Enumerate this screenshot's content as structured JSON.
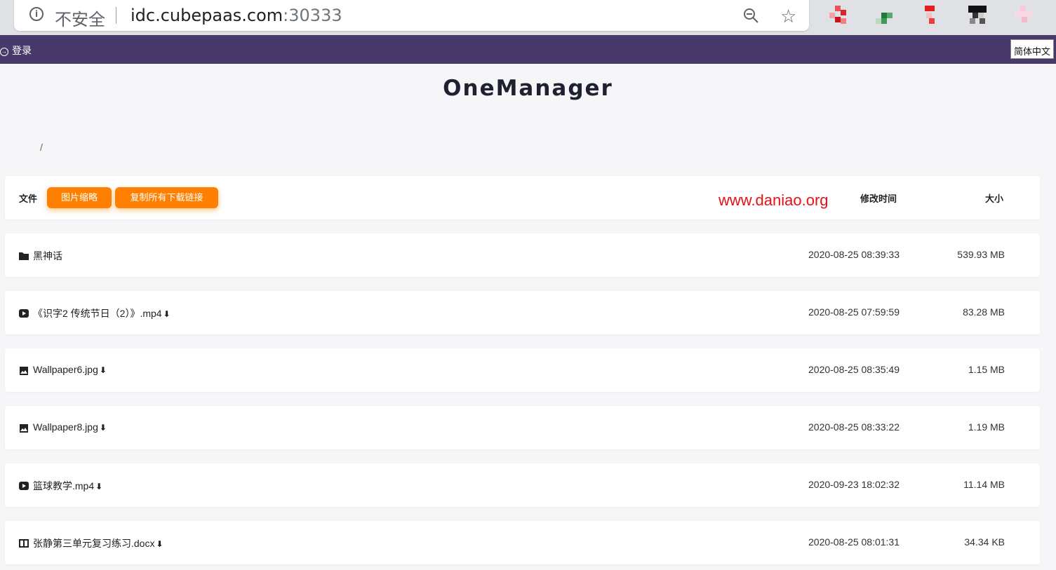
{
  "browser": {
    "security_label": "不安全",
    "url_host": "idc.cubepaas.com",
    "url_port": ":30333",
    "icons": [
      "info-icon",
      "zoom-icon",
      "star-icon"
    ]
  },
  "nav": {
    "login_label": "登录",
    "language": "简体中文",
    "bg_color": "#473a6b"
  },
  "site_title": "OneManager",
  "breadcrumb": "/",
  "list_header": {
    "file_label": "文件",
    "thumb_button": "图片缩略",
    "copy_links_button": "复制所有下载链接",
    "watermark": "www.daniao.org",
    "time_label": "修改时间",
    "size_label": "大小",
    "button_color": "#ff8000"
  },
  "files": [
    {
      "icon": "folder-icon",
      "name": "黑神话",
      "download": "",
      "time": "2020-08-25 08:39:33",
      "size": "539.93 MB"
    },
    {
      "icon": "video-icon",
      "name": "《识字2 传统节日（2）》.mp4",
      "download": "⬇",
      "time": "2020-08-25 07:59:59",
      "size": "83.28 MB"
    },
    {
      "icon": "image-icon",
      "name": "Wallpaper6.jpg",
      "download": "⬇",
      "time": "2020-08-25 08:35:49",
      "size": "1.15 MB"
    },
    {
      "icon": "image-icon",
      "name": "Wallpaper8.jpg",
      "download": "⬇",
      "time": "2020-08-25 08:33:22",
      "size": "1.19 MB"
    },
    {
      "icon": "video-icon",
      "name": "篮球教学.mp4",
      "download": "⬇",
      "time": "2020-09-23 18:02:32",
      "size": "11.14 MB"
    },
    {
      "icon": "document-icon",
      "name": "张静第三单元复习练习.docx",
      "download": "⬇",
      "time": "2020-08-25 08:01:31",
      "size": "34.34 KB"
    }
  ]
}
